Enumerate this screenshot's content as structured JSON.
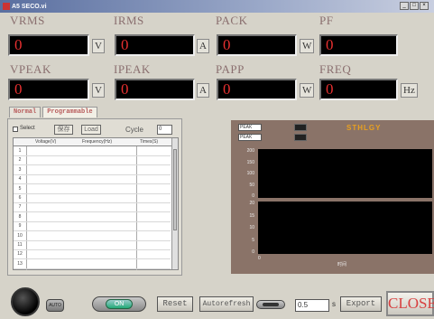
{
  "window": {
    "title": "A5 SECO.vi"
  },
  "meters": [
    {
      "label": "VRMS",
      "value": "0",
      "unit": "V"
    },
    {
      "label": "IRMS",
      "value": "0",
      "unit": "A"
    },
    {
      "label": "PACK",
      "value": "0",
      "unit": "W"
    },
    {
      "label": "PF",
      "value": "0",
      "unit": ""
    },
    {
      "label": "VPEAK",
      "value": "0",
      "unit": "V"
    },
    {
      "label": "IPEAK",
      "value": "0",
      "unit": "A"
    },
    {
      "label": "PAPP",
      "value": "0",
      "unit": "W"
    },
    {
      "label": "FREQ",
      "value": "0",
      "unit": "Hz"
    }
  ],
  "tabs": [
    {
      "label": "Normal"
    },
    {
      "label": "Programmable"
    }
  ],
  "program": {
    "select_label": "Select",
    "save_label": "保存",
    "load_label": "Load",
    "cycle_label": "Cycle",
    "cycle_value": "0",
    "columns": [
      "Voltage(V)",
      "Frequency(Hz)",
      "Times(S)"
    ],
    "rows": [
      "1",
      "2",
      "3",
      "4",
      "5",
      "6",
      "7",
      "8",
      "9",
      "10",
      "11",
      "12",
      "13"
    ]
  },
  "chart": {
    "legend": [
      "PEAK",
      "PEAK"
    ],
    "brand": "STHLGY",
    "upper_ticks": [
      "200",
      "150",
      "100",
      "50",
      "0"
    ],
    "lower_ticks": [
      "20",
      "15",
      "10",
      "5",
      "0"
    ],
    "x_tick": "0",
    "x_label": "时间"
  },
  "controls": {
    "auto_label": "AUTO",
    "run_label": "ON",
    "reset_label": "Reset",
    "autorefresh_label": "Autorefresh",
    "refresh_value": "0.5",
    "refresh_unit": "s",
    "export_label": "Export",
    "close_label": "CLOSE"
  },
  "colors": {
    "meter_text": "#e83030",
    "label": "#8a6f6f",
    "close": "#d84040"
  }
}
